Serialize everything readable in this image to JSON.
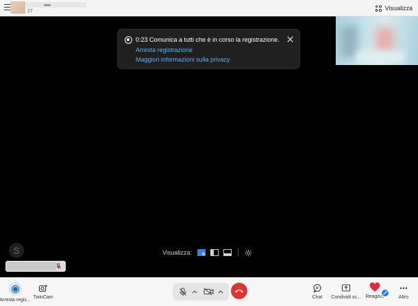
{
  "header": {
    "time": "27",
    "view_label": "Visualizza"
  },
  "notification": {
    "message": "0:23 Comunica a tutti che è in corso la registrazione.",
    "stop_link": "Arresta registrazione",
    "privacy_link": "Maggiori informazioni sulla privacy"
  },
  "layout_bar": {
    "label": "Visualizza:"
  },
  "skype": {
    "logo_letter": "S"
  },
  "toolbar": {
    "stop_recording": "Arresta regis...",
    "twincam": "TwinCam",
    "chat": "Chat",
    "share": "Condividi sc...",
    "react": "Reagisci",
    "more": "Altro"
  },
  "colors": {
    "link": "#5ab1f2",
    "hangup": "#d93636",
    "accent": "#2c63c7"
  },
  "icons": [
    "menu-icon",
    "grid-icon",
    "record-icon",
    "close-icon",
    "skype-icon",
    "mic-off-icon",
    "video-off-icon",
    "chevron-up-icon",
    "phone-hangup-icon",
    "chat-icon",
    "share-screen-icon",
    "heart-icon",
    "more-icon",
    "settings-icon",
    "camera-icon"
  ]
}
